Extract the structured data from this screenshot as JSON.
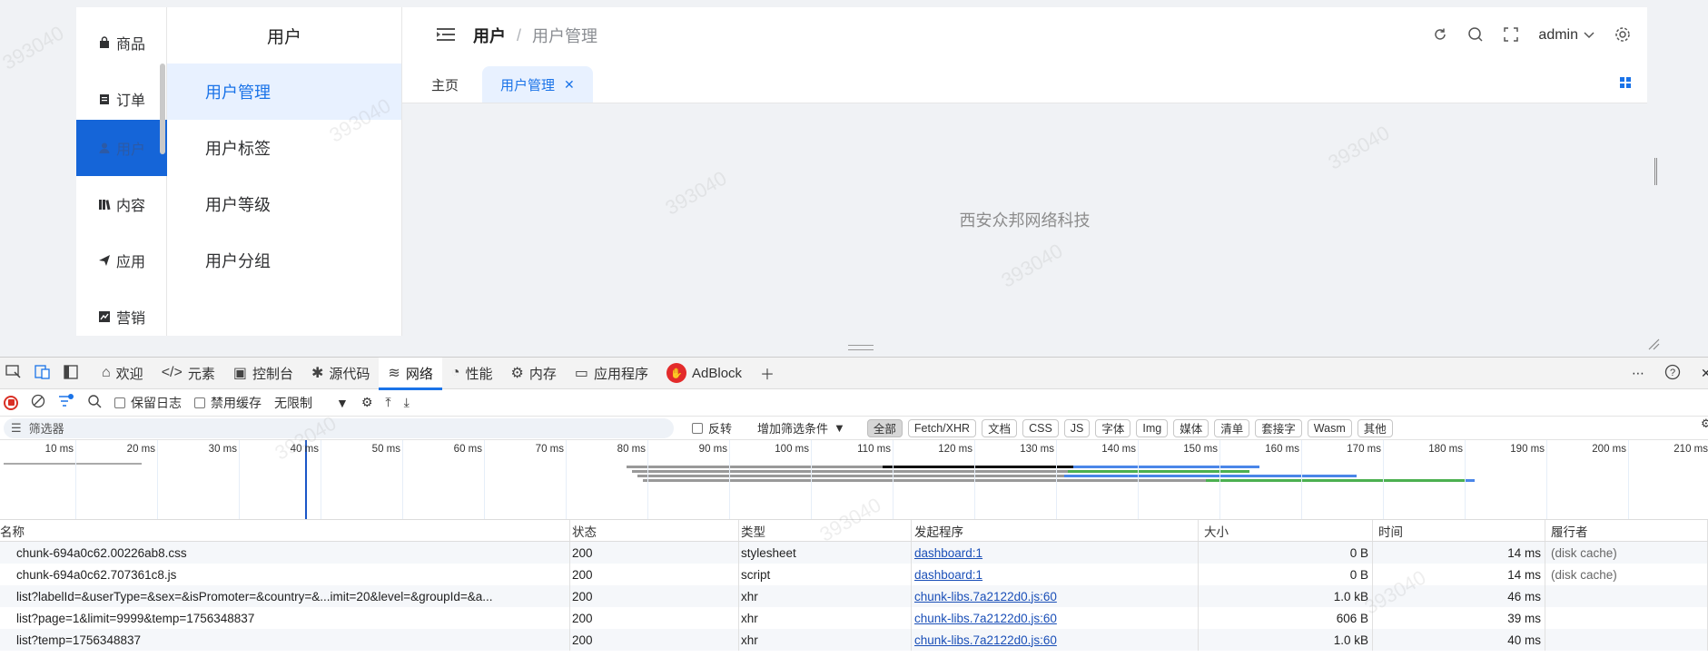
{
  "rail": {
    "items": [
      {
        "label": "商品",
        "icon": "bag-icon"
      },
      {
        "label": "订单",
        "icon": "clipboard-icon"
      },
      {
        "label": "用户",
        "icon": "user-icon"
      },
      {
        "label": "内容",
        "icon": "books-icon"
      },
      {
        "label": "应用",
        "icon": "send-icon"
      },
      {
        "label": "营销",
        "icon": "chart-icon"
      }
    ]
  },
  "submenu": {
    "title": "用户",
    "items": [
      "用户管理",
      "用户标签",
      "用户等级",
      "用户分组"
    ]
  },
  "navbar": {
    "breadcrumb": [
      "用户",
      "/",
      "用户管理"
    ],
    "user": "admin"
  },
  "tabs": [
    "主页",
    "用户管理"
  ],
  "content": {
    "footer_text": "西安众邦网络科技"
  },
  "watermark": "393040",
  "devtools": {
    "tabs": [
      "欢迎",
      "元素",
      "控制台",
      "源代码",
      "网络",
      "性能",
      "内存",
      "应用程序",
      "AdBlock"
    ],
    "active_tab": "网络",
    "toolbar": {
      "preserve_log": "保留日志",
      "disable_cache": "禁用缓存",
      "throttle": "无限制"
    },
    "filter": {
      "placeholder": "筛选器",
      "invert": "反转",
      "more": "增加筛选条件",
      "chips": [
        "全部",
        "Fetch/XHR",
        "文档",
        "CSS",
        "JS",
        "字体",
        "Img",
        "媒体",
        "清单",
        "套接字",
        "Wasm",
        "其他"
      ]
    },
    "timeline_ticks": [
      "10 ms",
      "20 ms",
      "30 ms",
      "40 ms",
      "50 ms",
      "60 ms",
      "70 ms",
      "80 ms",
      "90 ms",
      "100 ms",
      "110 ms",
      "120 ms",
      "130 ms",
      "140 ms",
      "150 ms",
      "160 ms",
      "170 ms",
      "180 ms",
      "190 ms",
      "200 ms",
      "210 ms"
    ],
    "columns": [
      "名称",
      "状态",
      "类型",
      "发起程序",
      "大小",
      "时间",
      "履行者"
    ],
    "rows": [
      {
        "name": "chunk-694a0c62.00226ab8.css",
        "status": "200",
        "type": "stylesheet",
        "initiator": "dashboard:1",
        "size": "0 B",
        "time": "14 ms",
        "fulfilled": "(disk cache)"
      },
      {
        "name": "chunk-694a0c62.707361c8.js",
        "status": "200",
        "type": "script",
        "initiator": "dashboard:1",
        "size": "0 B",
        "time": "14 ms",
        "fulfilled": "(disk cache)"
      },
      {
        "name": "list?labelId=&userType=&sex=&isPromoter=&country=&...imit=20&level=&groupId=&a...",
        "status": "200",
        "type": "xhr",
        "initiator": "chunk-libs.7a2122d0.js:60",
        "size": "1.0 kB",
        "time": "46 ms",
        "fulfilled": ""
      },
      {
        "name": "list?page=1&limit=9999&temp=1756348837",
        "status": "200",
        "type": "xhr",
        "initiator": "chunk-libs.7a2122d0.js:60",
        "size": "606 B",
        "time": "39 ms",
        "fulfilled": ""
      },
      {
        "name": "list?temp=1756348837",
        "status": "200",
        "type": "xhr",
        "initiator": "chunk-libs.7a2122d0.js:60",
        "size": "1.0 kB",
        "time": "40 ms",
        "fulfilled": ""
      }
    ]
  }
}
